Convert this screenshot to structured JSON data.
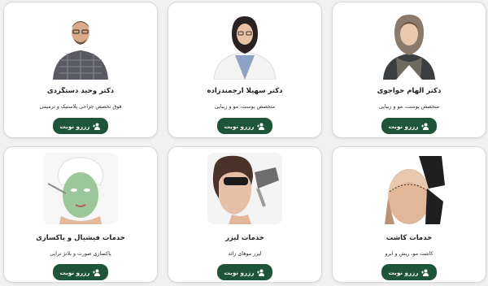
{
  "cards": [
    {
      "id": "elham-khajavi",
      "title": "دکتر الهام خواجوی",
      "subtitle": "متخصص پوست، مو و زیبایی",
      "button_label": "رزرو نوبت",
      "photo": "doctor-woman-hijab-photo"
    },
    {
      "id": "soheila-arjmandzadeh",
      "title": "دکتر سهیلا ارجمندزاده",
      "subtitle": "متخصص پوست، مو و زیبایی",
      "button_label": "رزرو نوبت",
      "photo": "doctor-woman-white-coat-photo"
    },
    {
      "id": "vahid-dastgerdi",
      "title": "دکتر وحید دستگردی",
      "subtitle": "فوق تخصص جراحی پلاستیک و ترمیمی",
      "button_label": "رزرو نوبت",
      "photo": "doctor-man-photo"
    },
    {
      "id": "hair-transplant",
      "title": "خدمات کاشت",
      "subtitle": "کاشت مو، ریش و ابرو",
      "button_label": "رزرو نوبت",
      "photo": "hair-transplant-photo"
    },
    {
      "id": "laser",
      "title": "خدمات لیزر",
      "subtitle": "لیزر موهای زائد",
      "button_label": "رزرو نوبت",
      "photo": "laser-treatment-photo"
    },
    {
      "id": "facial",
      "title": "خدمات فیشیال و پاکسازی",
      "subtitle": "پاکسازی صورت و بلانژ تراپی",
      "button_label": "رزرو نوبت",
      "photo": "facial-mask-photo"
    }
  ],
  "colors": {
    "button_bg": "#1e5439",
    "button_text": "#ffffff",
    "card_bg": "#ffffff",
    "page_bg": "#f1f1f1"
  },
  "icons": {
    "button_icon": "user-plus-icon"
  }
}
